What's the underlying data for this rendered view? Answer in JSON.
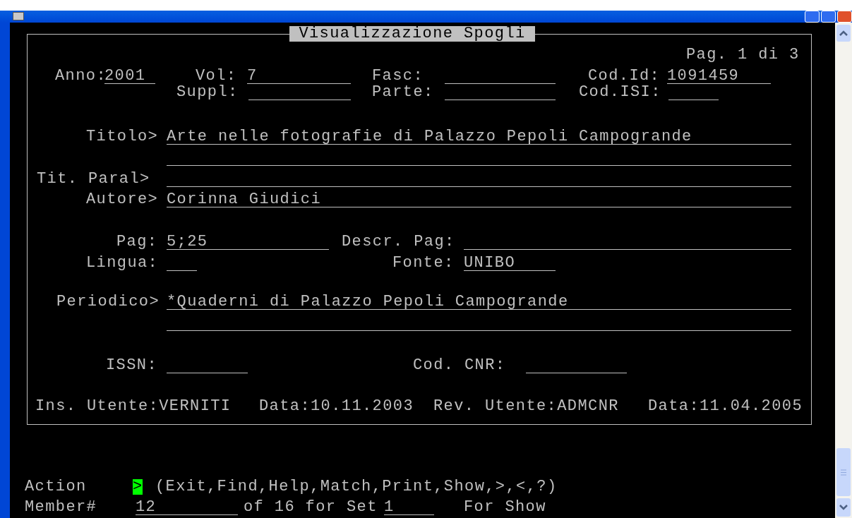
{
  "form": {
    "title": "Visualizzazione Spogli",
    "page": "Pag. 1 di 3",
    "fields": [
      {
        "kind": "labeled",
        "label": "Anno:",
        "value": "2001"
      },
      {
        "kind": "labeled",
        "label": "Vol:",
        "value": "7"
      },
      {
        "kind": "labeled",
        "label": "Fasc:"
      },
      {
        "kind": "labeled",
        "label": "Cod.Id:",
        "value": "1091459"
      },
      {
        "kind": "labeled",
        "label": "Suppl:"
      },
      {
        "kind": "labeled",
        "label": "Parte:"
      },
      {
        "kind": "labeled",
        "label": "Cod.ISI:"
      },
      {
        "kind": "labeled",
        "label": "Titolo>",
        "value": "Arte nelle fotografie di Palazzo Pepoli Campogrande"
      },
      {
        "kind": "continuation"
      },
      {
        "kind": "labeled",
        "label": "Tit. Paral>"
      },
      {
        "kind": "labeled",
        "label": "Autore>",
        "value": "Corinna Giudici"
      },
      {
        "kind": "labeled",
        "label": "Pag:",
        "value": "5;25"
      },
      {
        "kind": "labeled",
        "label": "Descr. Pag:"
      },
      {
        "kind": "labeled",
        "label": "Lingua:"
      },
      {
        "kind": "labeled",
        "label": "Fonte:",
        "value": "UNIBO"
      },
      {
        "kind": "labeled",
        "label": "Periodico>",
        "value": "*Quaderni di Palazzo Pepoli Campogrande"
      },
      {
        "kind": "continuation"
      },
      {
        "kind": "labeled",
        "label": "ISSN:"
      },
      {
        "kind": "labeled",
        "label": "Cod. CNR:"
      }
    ],
    "audit": [
      {
        "label": "Ins. Utente:",
        "value": "VERNITI"
      },
      {
        "label": "Data:",
        "value": "10.11.2003"
      },
      {
        "label": "Rev. Utente:",
        "value": "ADMCNR"
      },
      {
        "label": "Data:",
        "value": "11.04.2005"
      }
    ]
  },
  "command": {
    "action_label": "Action",
    "prompt": ">",
    "options": "(Exit,Find,Help,Match,Print,Show,>,<,?)",
    "member_label": "Member#",
    "member": "12",
    "of_text": "of 16 for Set",
    "set": "1",
    "mode": "For Show"
  }
}
